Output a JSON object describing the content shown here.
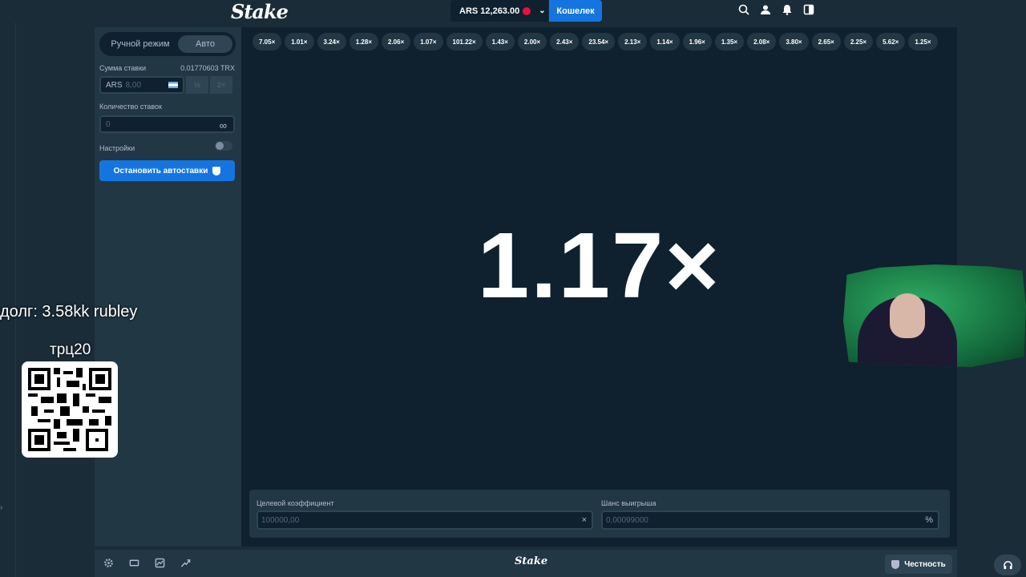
{
  "header": {
    "logo": "Stake",
    "balance": "ARS 12,263.00",
    "wallet_label": "Кошелек"
  },
  "sidebar": {
    "mode_manual": "Ручной режим",
    "mode_auto": "Авто",
    "bet_amount_label": "Сумма ставки",
    "bet_amount_crypto": "0.01770603 TRX",
    "bet_currency": "ARS",
    "bet_value": "8,00",
    "half_label": "½",
    "double_label": "2×",
    "bets_count_label": "Количество ставок",
    "bets_count_value": "0",
    "infinity_symbol": "∞",
    "settings_label": "Настройки",
    "stop_button": "Остановить автоставки"
  },
  "history": [
    "7.05×",
    "1.01×",
    "3.24×",
    "1.28×",
    "2.06×",
    "1.07×",
    "101.22×",
    "1.43×",
    "2.00×",
    "2.43×",
    "23.54×",
    "2.13×",
    "1.14×",
    "1.96×",
    "1.35×",
    "2.08×",
    "3.80×",
    "2.65×",
    "2.25×",
    "5.62×",
    "1.25×"
  ],
  "game": {
    "multiplier": "1.17×"
  },
  "bottom": {
    "target_label": "Целевой коэффициент",
    "target_value": "100000,00",
    "target_suffix": "×",
    "chance_label": "Шанс выигрыша",
    "chance_value": "0,00099000",
    "chance_suffix": "%"
  },
  "footer": {
    "logo": "Stake",
    "fairness_label": "Честность"
  },
  "overlay": {
    "debt_text": "долг: 3.58kk rubley",
    "code_text": "трц20"
  },
  "colors": {
    "background": "#1a2c38",
    "panel": "#213743",
    "game_bg": "#0f212e",
    "accent": "#1475e1",
    "danger": "#e9113c"
  }
}
